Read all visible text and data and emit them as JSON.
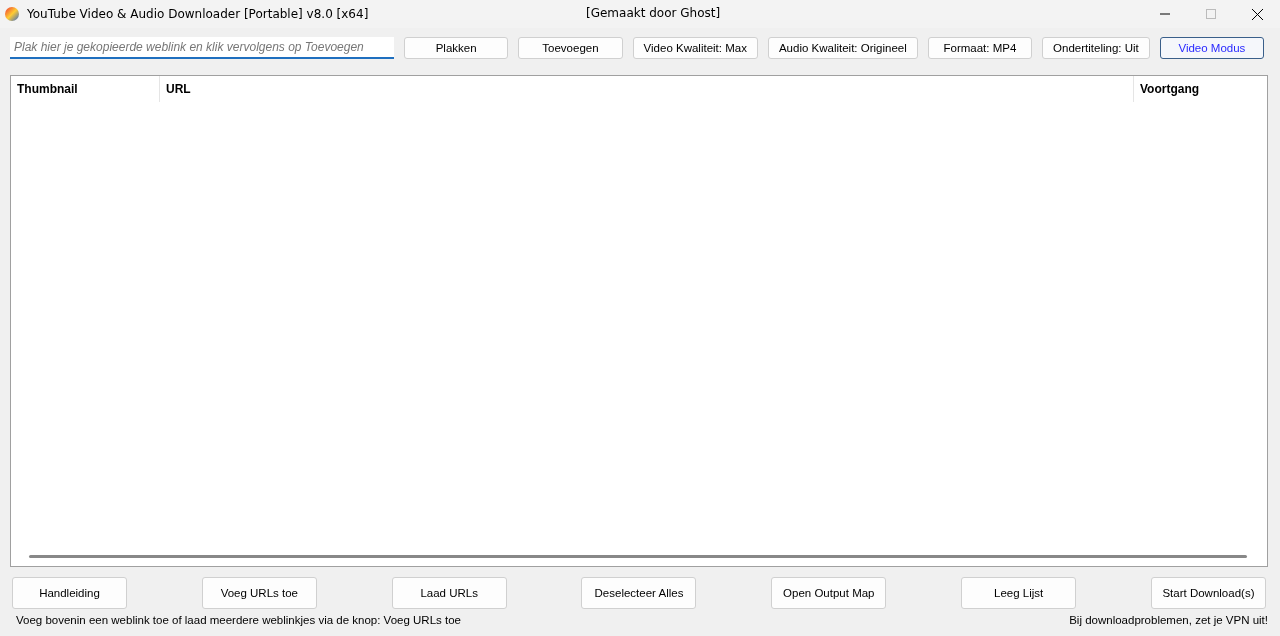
{
  "window": {
    "title": "YouTube Video & Audio Downloader [Portable] v8.0 [x64]",
    "subtitle": "[Gemaakt door Ghost]"
  },
  "url_field": {
    "placeholder": "Plak hier je gekopieerde weblink en klik vervolgens op Toevoegen"
  },
  "toolbar": [
    {
      "label": "Plakken",
      "selected": false
    },
    {
      "label": "Toevoegen",
      "selected": false
    },
    {
      "label": "Video Kwaliteit: Max",
      "selected": false
    },
    {
      "label": "Audio Kwaliteit: Origineel",
      "selected": false
    },
    {
      "label": "Formaat: MP4",
      "selected": false
    },
    {
      "label": "Ondertiteling: Uit",
      "selected": false
    },
    {
      "label": "Video Modus",
      "selected": true
    }
  ],
  "table": {
    "columns": [
      "Thumbnail",
      "URL",
      "Voortgang"
    ]
  },
  "actions": [
    "Handleiding",
    "Voeg URLs toe",
    "Laad URLs",
    "Deselecteer Alles",
    "Open Output Map",
    "Leeg Lijst",
    "Start Download(s)"
  ],
  "status_bar": {
    "left": "Voeg bovenin een weblink toe of laad meerdere weblinkjes via de knop: Voeg URLs toe",
    "right": "Bij downloadproblemen, zet je VPN uit!"
  }
}
